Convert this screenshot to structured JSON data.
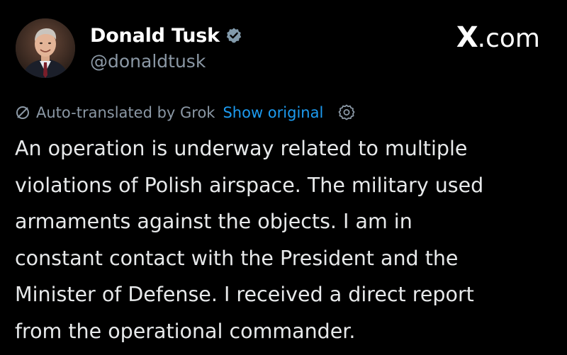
{
  "author": {
    "display_name": "Donald Tusk",
    "handle": "@donaldtusk",
    "verified": true
  },
  "brand": {
    "logo": "X",
    "domain": ".com"
  },
  "translation": {
    "label": "Auto-translated by Grok",
    "show_original_label": "Show original"
  },
  "post": {
    "lines": [
      "An operation is underway related to multiple",
      "violations of Polish airspace. The military used",
      "armaments against the objects. I am in",
      "constant contact with the President and the",
      "Minister of Defense. I received a direct report",
      "from the operational commander."
    ]
  },
  "colors": {
    "background": "#000000",
    "text": "#e7e9ea",
    "secondary": "#8b98a5",
    "link": "#1d9bf0",
    "verified_badge": "#829aab"
  },
  "icons": {
    "avatar": "profile-photo",
    "verified": "verified-badge-icon",
    "translate": "no-entry-icon",
    "settings": "gear-icon"
  }
}
